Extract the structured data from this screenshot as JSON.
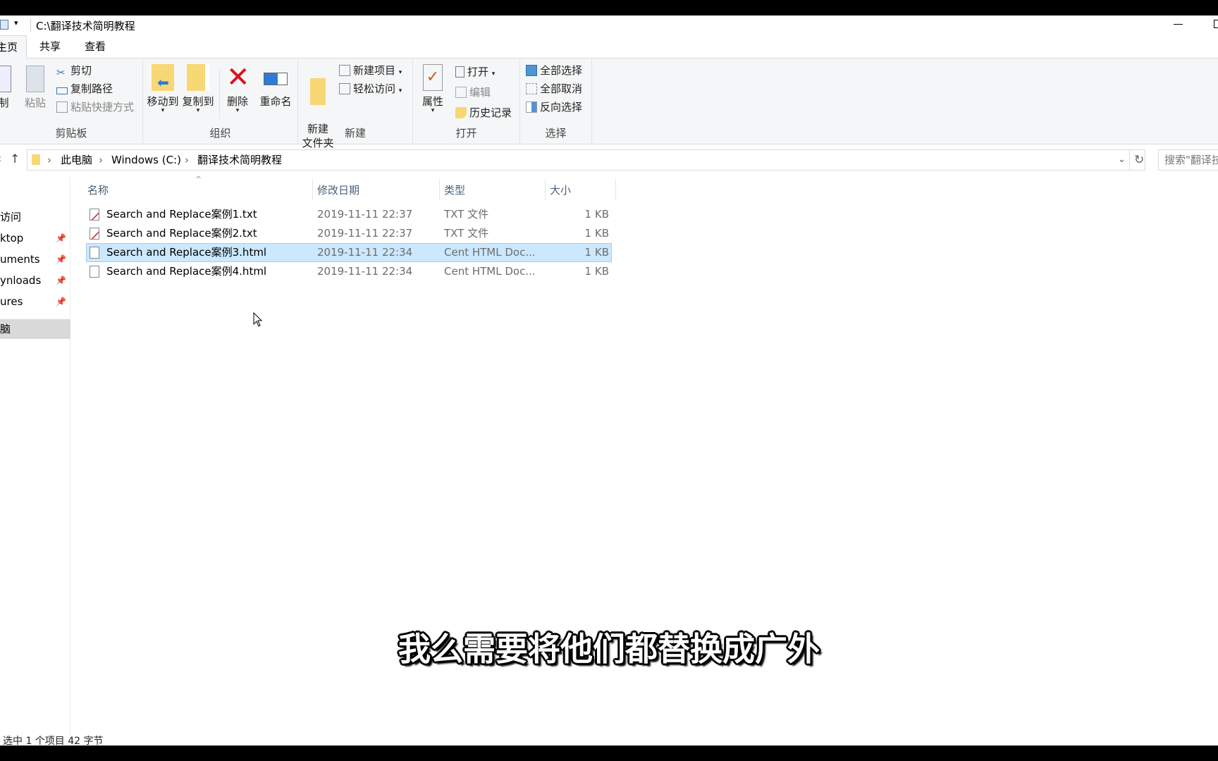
{
  "window": {
    "title": "C:\\翻译技术简明教程",
    "minimize_icon": "minimize-icon"
  },
  "tabs": [
    {
      "label": "主页"
    },
    {
      "label": "共享"
    },
    {
      "label": "查看"
    }
  ],
  "ribbon": {
    "clipboard": {
      "label": "剪贴板",
      "copy": "制",
      "paste": "粘贴",
      "cut": "剪切",
      "copy_path": "复制路径",
      "paste_shortcut": "粘贴快捷方式"
    },
    "organize": {
      "label": "组织",
      "move_to": "移动到",
      "copy_to": "复制到",
      "delete": "删除",
      "rename": "重命名"
    },
    "new": {
      "label": "新建",
      "new_folder": "新建\n文件夹",
      "new_item": "新建项目",
      "easy_access": "轻松访问"
    },
    "open": {
      "label": "打开",
      "properties": "属性",
      "open": "打开",
      "edit": "编辑",
      "history": "历史记录"
    },
    "select": {
      "label": "选择",
      "select_all": "全部选择",
      "select_none": "全部取消",
      "invert": "反向选择"
    }
  },
  "address": {
    "crumbs": [
      "此电脑",
      "Windows (C:)",
      "翻译技术简明教程"
    ],
    "search_placeholder": "搜索\"翻译技"
  },
  "sidebar": {
    "items": [
      {
        "label": "访问",
        "pinned": false
      },
      {
        "label": "ktop",
        "pinned": true
      },
      {
        "label": "uments",
        "pinned": true
      },
      {
        "label": "ynloads",
        "pinned": true
      },
      {
        "label": "ures",
        "pinned": true
      },
      {
        "label": "脑",
        "pinned": false,
        "selected": true
      }
    ]
  },
  "columns": {
    "name": "名称",
    "date": "修改日期",
    "type": "类型",
    "size": "大小"
  },
  "files": [
    {
      "name": "Search and Replace案例1.txt",
      "date": "2019-11-11 22:37",
      "type": "TXT 文件",
      "size": "1 KB",
      "icon": "txt-file-icon"
    },
    {
      "name": "Search and Replace案例2.txt",
      "date": "2019-11-11 22:37",
      "type": "TXT 文件",
      "size": "1 KB",
      "icon": "txt-file-icon"
    },
    {
      "name": "Search and Replace案例3.html",
      "date": "2019-11-11 22:34",
      "type": "Cent HTML Doc...",
      "size": "1 KB",
      "icon": "html-file-icon",
      "selected": true
    },
    {
      "name": "Search and Replace案例4.html",
      "date": "2019-11-11 22:34",
      "type": "Cent HTML Doc...",
      "size": "1 KB",
      "icon": "html-file-icon"
    }
  ],
  "status": "选中 1 个项目  42 字节",
  "subtitle": "我么需要将他们都替换成广外",
  "colors": {
    "selection": "#cce8ff",
    "selection_border": "#99d1ff",
    "ribbon_bg": "#f5f6f7",
    "delete_red": "#d9121b"
  }
}
